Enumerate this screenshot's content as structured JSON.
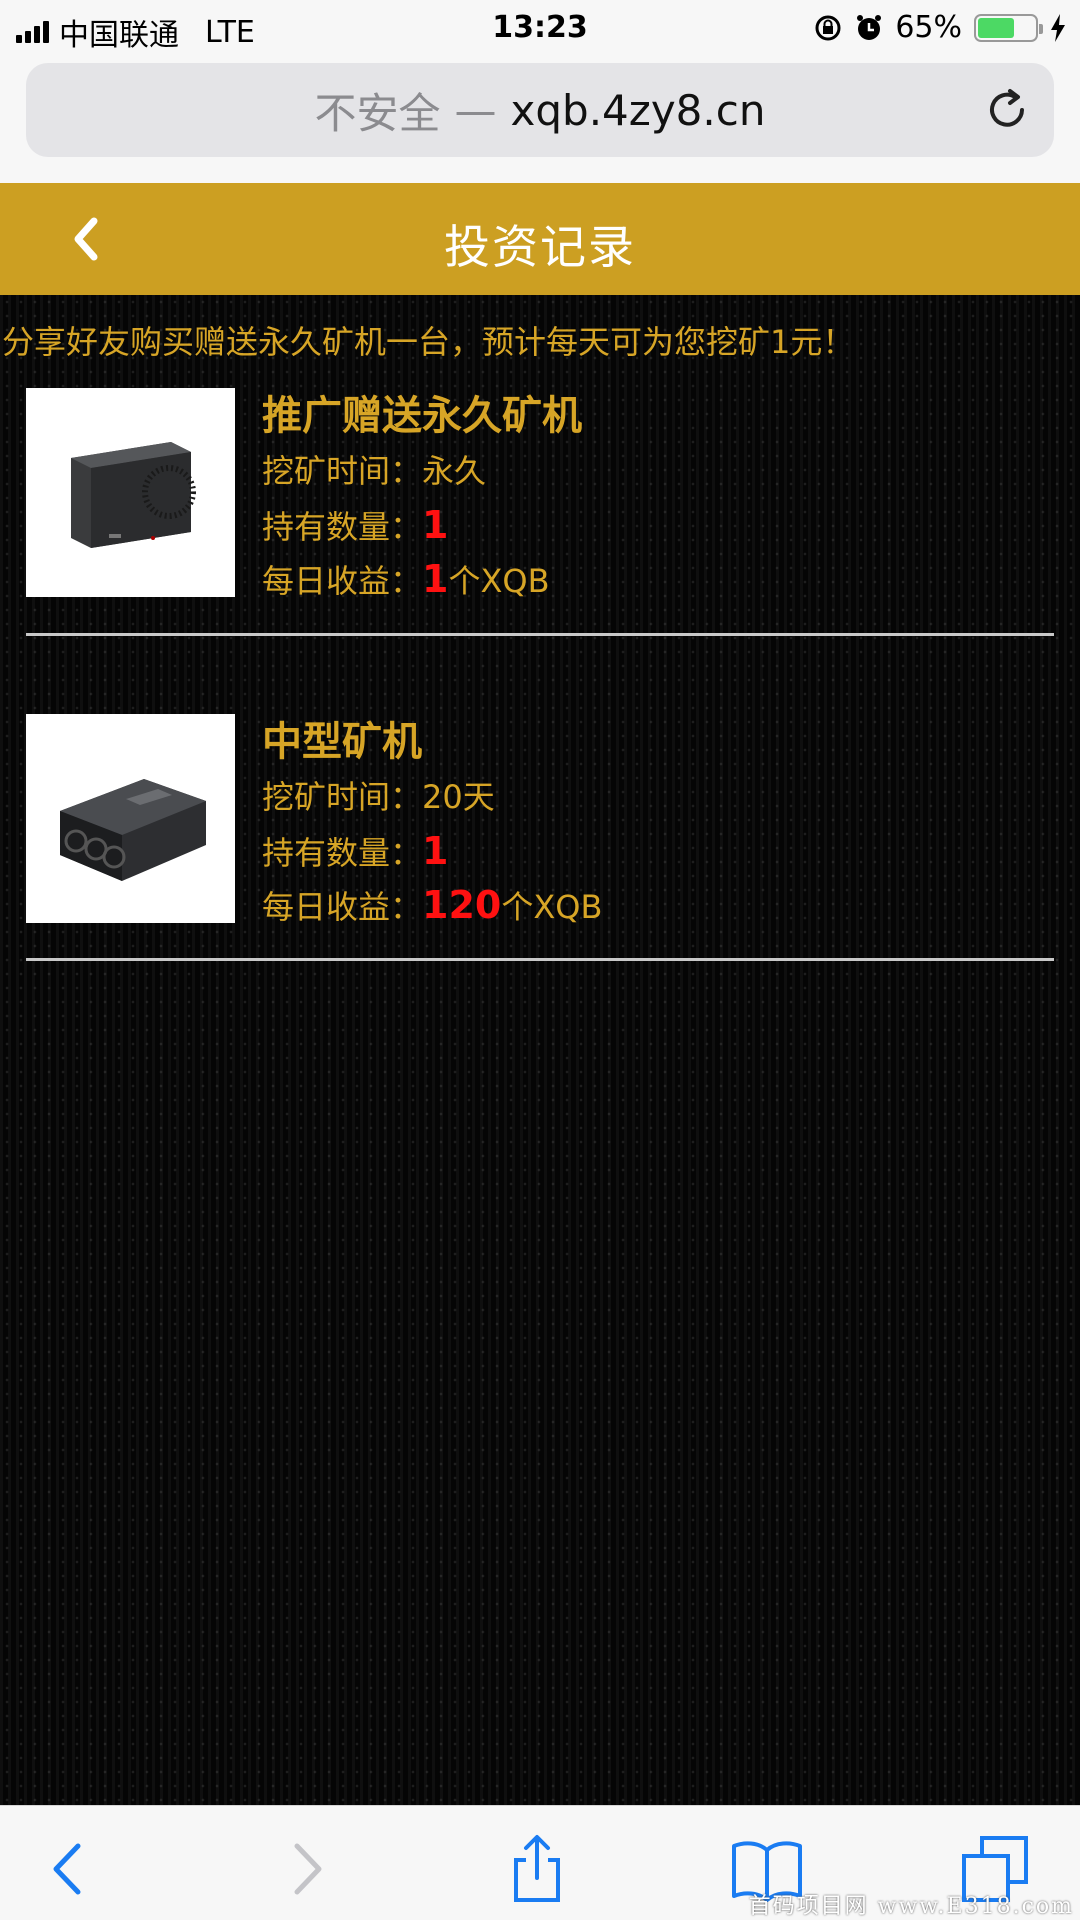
{
  "status_bar": {
    "carrier": "中国联通",
    "network": "LTE",
    "time": "13:23",
    "battery_percent": "65%",
    "battery_level": 0.65
  },
  "address_bar": {
    "insecure_label": "不安全",
    "dash": "—",
    "domain": "xqb.4zy8.cn"
  },
  "header": {
    "title": "投资记录"
  },
  "notice": "分享好友购买赠送永久矿机一台，预计每天可为您挖矿1元！",
  "records": [
    {
      "title": "推广赠送永久矿机",
      "duration_label": "挖矿时间：",
      "duration_value": "永久",
      "quantity_label": "持有数量：",
      "quantity_value": "1",
      "income_label": "每日收益：",
      "income_value": "1",
      "income_unit": "个XQB"
    },
    {
      "title": "中型矿机",
      "duration_label": "挖矿时间：",
      "duration_value": "20天",
      "quantity_label": "持有数量：",
      "quantity_value": "1",
      "income_label": "每日收益：",
      "income_value": "120",
      "income_unit": "个XQB"
    }
  ],
  "toolbar": {
    "icons": [
      "back-icon",
      "forward-icon",
      "share-icon",
      "bookmarks-icon",
      "tabs-icon"
    ]
  },
  "watermark": "首码项目网 www.E318.com",
  "colors": {
    "header_bg": "#cc9f22",
    "gold_text": "#d7a526",
    "highlight_red": "#ff1111",
    "ios_blue": "#1a7cf2"
  }
}
